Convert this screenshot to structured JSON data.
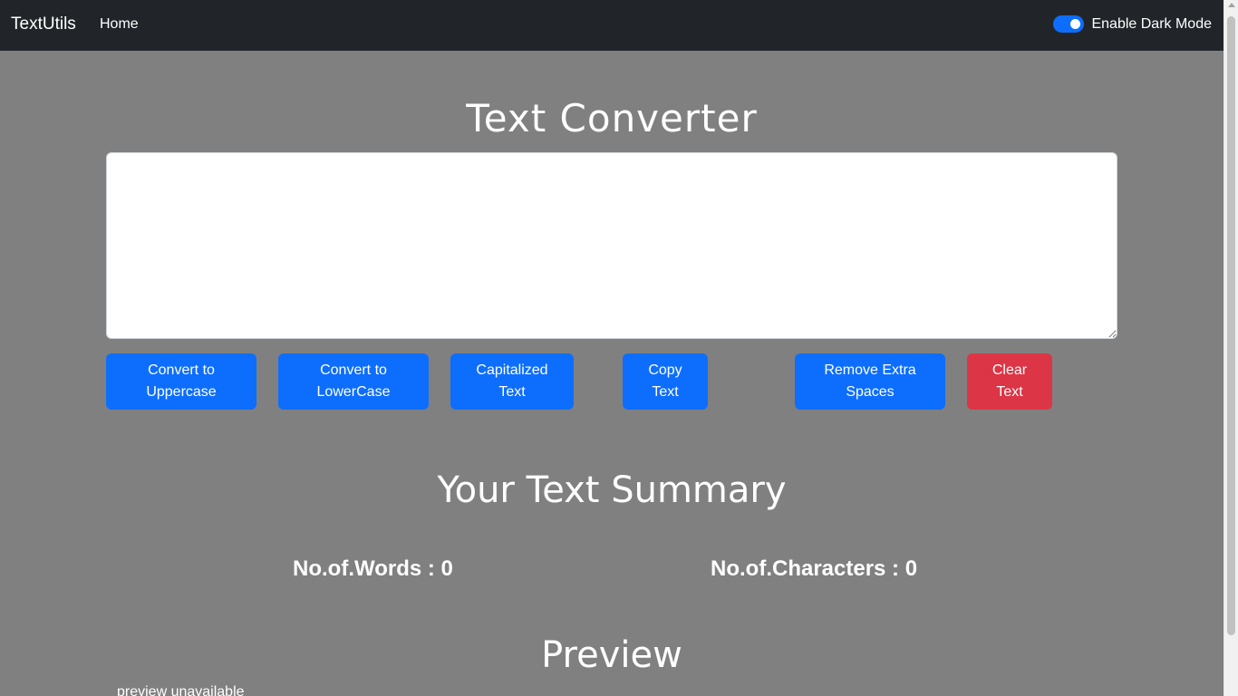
{
  "navbar": {
    "brand": "TextUtils",
    "links": [
      {
        "label": "Home"
      }
    ],
    "dark_mode": {
      "label": "Enable Dark Mode",
      "enabled": true
    }
  },
  "converter": {
    "title": "Text Converter",
    "textarea": {
      "value": "",
      "placeholder": ""
    },
    "buttons": {
      "uppercase": "Convert to Uppercase",
      "lowercase": "Convert to LowerCase",
      "capitalized": "Capitalized Text",
      "copy": "Copy Text",
      "remove_spaces": "Remove Extra Spaces",
      "clear": "Clear Text"
    }
  },
  "summary": {
    "title": "Your Text Summary",
    "words_label": "No.of.Words : 0",
    "chars_label": "No.of.Characters : 0"
  },
  "preview": {
    "title": "Preview",
    "text": "preview unavailable"
  },
  "colors": {
    "navbar_bg": "#212529",
    "page_bg": "#808080",
    "primary": "#0d6efd",
    "danger": "#dc3545"
  }
}
